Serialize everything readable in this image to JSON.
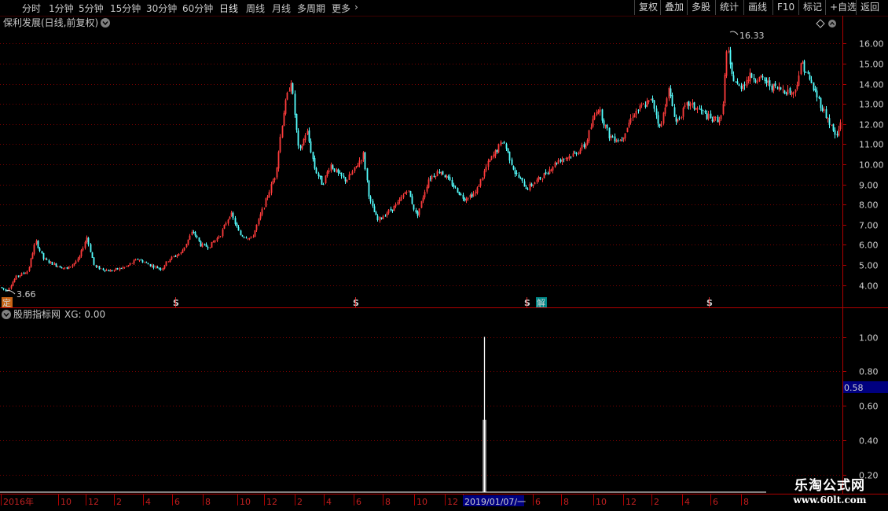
{
  "toolbar": {
    "periods": [
      "分时",
      "1分钟",
      "5分钟",
      "15分钟",
      "30分钟",
      "60分钟",
      "日线",
      "周线",
      "月线",
      "多周期",
      "更多"
    ],
    "active_period": "日线",
    "right_buttons": [
      "复权",
      "叠加",
      "多股",
      "统计",
      "画线",
      "F10",
      "标记",
      "+自选",
      "返回"
    ]
  },
  "main_chart": {
    "title": "保利发展(日线,前复权)",
    "high_label": "16.33",
    "low_label": "3.66",
    "markers": [
      {
        "label": "定",
        "type": "ding",
        "date": "2016-01"
      },
      {
        "label": "S",
        "type": "s",
        "date": "2017-01"
      },
      {
        "label": "S",
        "type": "s",
        "date": "2018-01"
      },
      {
        "label": "S",
        "type": "s",
        "date": "2019-01"
      },
      {
        "label": "解",
        "type": "jie",
        "date": "2019-02"
      },
      {
        "label": "S",
        "type": "s",
        "date": "2020-01"
      }
    ]
  },
  "indicator": {
    "title": "股朋指标网",
    "value_label": "XG: 0.00",
    "current_value_badge": "0.58"
  },
  "date_axis": {
    "labels": [
      "2016年",
      "10",
      "12",
      "2",
      "4",
      "6",
      "8",
      "10",
      "12",
      "2",
      "4",
      "6",
      "8",
      "10",
      "12",
      "2019/01/07/一",
      "6",
      "8",
      "10",
      "12",
      "2",
      "4",
      "6",
      "8"
    ]
  },
  "watermark": {
    "name": "乐淘公式网",
    "url": "www.60lt.com"
  },
  "colors": {
    "up": "#ff3c3c",
    "down": "#54ffff",
    "grid": "#7a0000",
    "axis": "#b00000",
    "badge": "#000080"
  },
  "chart_data": [
    {
      "type": "candlestick",
      "title": "保利发展(日线,前复权)",
      "ylim": [
        3.4,
        16.8
      ],
      "yticks": [
        4.0,
        5.0,
        6.0,
        7.0,
        8.0,
        9.0,
        10.0,
        11.0,
        12.0,
        13.0,
        14.0,
        15.0,
        16.0
      ],
      "grid": true,
      "max": 16.33,
      "min": 3.66,
      "path_x": [
        0,
        8,
        20,
        35,
        45,
        55,
        70,
        85,
        100,
        110,
        120,
        140,
        160,
        175,
        190,
        205,
        215,
        230,
        245,
        255,
        265,
        280,
        293,
        305,
        320,
        335,
        350,
        360,
        370,
        380,
        390,
        400,
        410,
        420,
        430,
        440,
        450,
        462,
        470,
        480,
        492,
        505,
        518,
        530,
        545,
        560,
        575,
        590,
        605,
        620,
        640,
        655,
        670,
        690,
        710,
        730,
        745,
        760,
        775,
        790,
        805,
        818,
        830,
        840,
        850,
        860,
        875,
        890,
        905,
        918,
        925,
        930,
        940,
        955,
        970,
        985,
        1000,
        1010,
        1020,
        1032,
        1045,
        1055,
        1064,
        1072
      ],
      "path_y": [
        3.9,
        3.7,
        4.4,
        4.7,
        6.2,
        5.3,
        5.0,
        4.8,
        5.3,
        6.4,
        4.9,
        4.7,
        4.9,
        5.3,
        5.0,
        4.8,
        5.3,
        5.6,
        6.7,
        6.0,
        5.9,
        6.5,
        7.6,
        6.5,
        6.3,
        7.9,
        9.5,
        12.5,
        14.2,
        10.5,
        11.7,
        9.8,
        9.0,
        10.0,
        9.5,
        9.2,
        9.7,
        10.5,
        8.2,
        7.2,
        7.6,
        8.0,
        8.8,
        7.4,
        9.3,
        9.7,
        9.0,
        8.3,
        8.6,
        10.0,
        11.2,
        9.6,
        8.8,
        9.4,
        10.2,
        10.5,
        11.0,
        12.9,
        11.4,
        11.2,
        12.5,
        12.9,
        13.2,
        11.7,
        13.8,
        12.1,
        13.0,
        12.7,
        12.2,
        12.3,
        15.9,
        14.5,
        13.8,
        14.4,
        14.2,
        13.8,
        13.7,
        13.5,
        15.1,
        14.0,
        12.9,
        12.1,
        11.3,
        12.5
      ]
    },
    {
      "type": "bar",
      "title": "股朋指标网",
      "series": [
        {
          "name": "XG",
          "values": [
            1.0
          ]
        }
      ],
      "signal_date": "2019/01/07",
      "ylim": [
        0.1,
        1.08
      ],
      "yticks": [
        0.2,
        0.4,
        0.6,
        0.8,
        1.0
      ],
      "grid": true
    }
  ]
}
